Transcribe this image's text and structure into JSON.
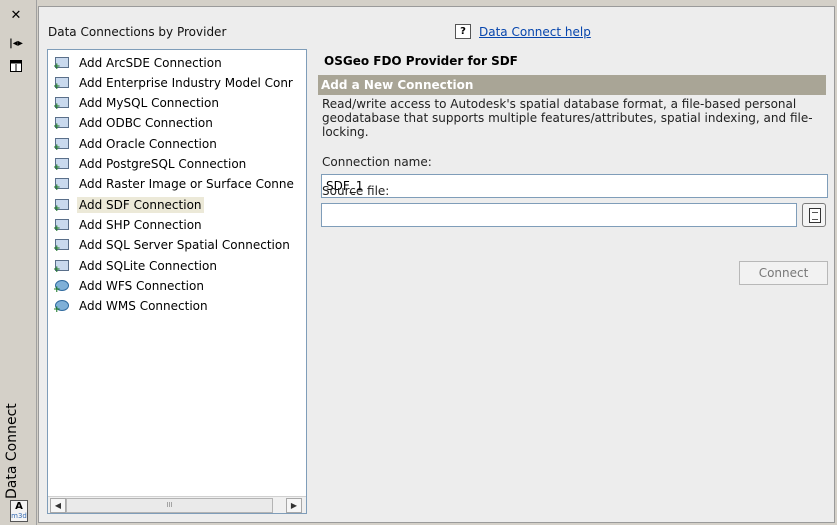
{
  "palette": "Data Connect",
  "app_badge": {
    "letter": "A",
    "sub": "m3d"
  },
  "providers_header": "Data Connections by Provider",
  "providers": [
    {
      "label": "Add ArcSDE Connection",
      "icon": "db-connection-icon"
    },
    {
      "label": "Add Enterprise Industry Model Conr",
      "icon": "db-connection-icon"
    },
    {
      "label": "Add MySQL Connection",
      "icon": "db-connection-icon"
    },
    {
      "label": "Add ODBC Connection",
      "icon": "db-connection-icon"
    },
    {
      "label": "Add Oracle Connection",
      "icon": "db-connection-icon"
    },
    {
      "label": "Add PostgreSQL Connection",
      "icon": "db-connection-icon"
    },
    {
      "label": "Add Raster Image or Surface Conne",
      "icon": "raster-connection-icon"
    },
    {
      "label": "Add SDF Connection",
      "icon": "file-connection-icon"
    },
    {
      "label": "Add SHP Connection",
      "icon": "file-connection-icon"
    },
    {
      "label": "Add SQL Server Spatial Connection",
      "icon": "db-connection-icon"
    },
    {
      "label": "Add SQLite Connection",
      "icon": "file-connection-icon"
    },
    {
      "label": "Add WFS Connection",
      "icon": "globe-connection-icon"
    },
    {
      "label": "Add WMS Connection",
      "icon": "globe-connection-icon"
    }
  ],
  "selected_index": 7,
  "help": {
    "icon_text": "?",
    "link": "Data Connect help"
  },
  "provider_title": "OSGeo FDO Provider for SDF",
  "section_title": "Add a New Connection",
  "description": "Read/write access to Autodesk's spatial database format, a file-based personal geodatabase that supports multiple features/attributes, spatial indexing, and file-locking.",
  "connection_name": {
    "label": "Connection name:",
    "value": "SDF_1"
  },
  "source_file": {
    "label": "Source file:",
    "value": ""
  },
  "connect_label": "Connect",
  "scrollbar": {
    "thumb_grip": "III"
  }
}
